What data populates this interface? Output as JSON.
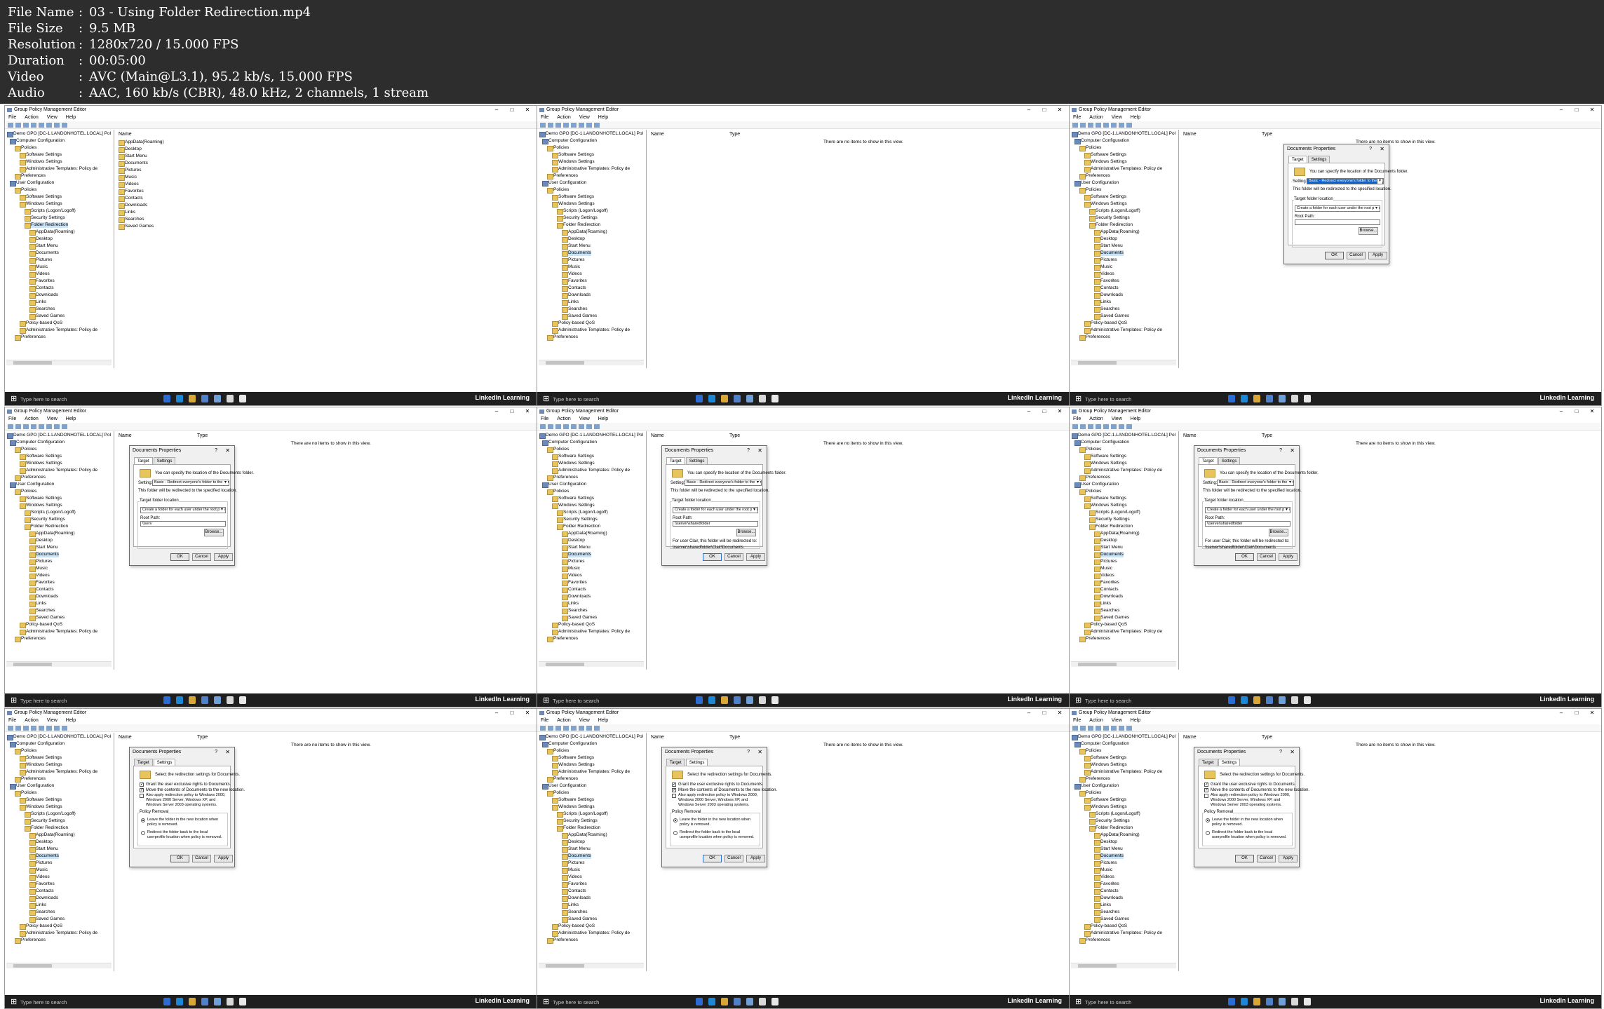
{
  "metadata": [
    {
      "key": "File Name",
      "value": "03 - Using Folder Redirection.mp4"
    },
    {
      "key": "File Size",
      "value": "9.5 MB"
    },
    {
      "key": "Resolution",
      "value": "1280x720 / 15.000 FPS"
    },
    {
      "key": "Duration",
      "value": "00:05:00"
    },
    {
      "key": "Video",
      "value": "AVC (Main@L3.1), 95.2 kb/s, 15.000 FPS"
    },
    {
      "key": "Audio",
      "value": "AAC, 160 kb/s (CBR), 48.0 kHz, 2 channels, 1 stream"
    }
  ],
  "separator": ":",
  "window": {
    "title": "Group Policy Management Editor",
    "menus": [
      "File",
      "Action",
      "View",
      "Help"
    ]
  },
  "tree": [
    "Demo GPO [DC-1.LANDONHOTEL.LOCAL] Pol",
    "Computer Configuration",
    "Policies",
    "Software Settings",
    "Windows Settings",
    "Administrative Templates: Policy de",
    "Preferences",
    "User Configuration",
    "Policies",
    "Software Settings",
    "Windows Settings",
    "Scripts (Logon/Logoff)",
    "Security Settings",
    "Folder Redirection",
    "AppData(Roaming)",
    "Desktop",
    "Start Menu",
    "Documents",
    "Pictures",
    "Music",
    "Videos",
    "Favorites",
    "Contacts",
    "Downloads",
    "Links",
    "Searches",
    "Saved Games",
    "Policy-based QoS",
    "Administrative Templates: Policy de",
    "Preferences"
  ],
  "list": {
    "col_name": "Name",
    "col_type": "Type",
    "empty": "There are no items to show in this view.",
    "folders": [
      "AppData(Roaming)",
      "Desktop",
      "Start Menu",
      "Documents",
      "Pictures",
      "Music",
      "Videos",
      "Favorites",
      "Contacts",
      "Downloads",
      "Links",
      "Searches",
      "Saved Games"
    ]
  },
  "taskbar": {
    "search": "Type here to search",
    "brand": "LinkedIn Learning"
  },
  "dialog": {
    "title": "Documents Properties",
    "help": "?",
    "close": "✕",
    "tab_target": "Target",
    "tab_settings": "Settings",
    "target_info": "You can specify the location of the Documents folder.",
    "setting_label": "Setting:",
    "setting_value": "Basic - Redirect everyone's folder to the same location",
    "redirect_note": "This folder will be redirected to the specified location.",
    "target_location_label": "Target folder location",
    "target_location_value": "Create a folder for each user under the root path",
    "root_path_label": "Root Path:",
    "root_path_partial": "\\\\serv",
    "root_path_full": "\\\\server\\sharedfolder",
    "browse": "Browse...",
    "redirect_for": "For user Clair, this folder will be redirected to:",
    "redirect_path": "\\\\server\\sharedfolder\\Clair\\Documents",
    "settings_info": "Select the redirection settings for Documents.",
    "grant_exclusive": "Grant the user exclusive rights to Documents.",
    "move_contents": "Move the contents of Documents to the new location.",
    "also_apply": "Also apply redirection policy to Windows 2000, Windows 2000 Server, Windows XP, and Windows Server 2003 operating systems.",
    "policy_removal": "Policy Removal",
    "leave_folder": "Leave the folder in the new location when policy is removed.",
    "redirect_back": "Redirect the folder back to the local userprofile location when policy is removed.",
    "ok": "OK",
    "cancel": "Cancel",
    "apply": "Apply"
  }
}
